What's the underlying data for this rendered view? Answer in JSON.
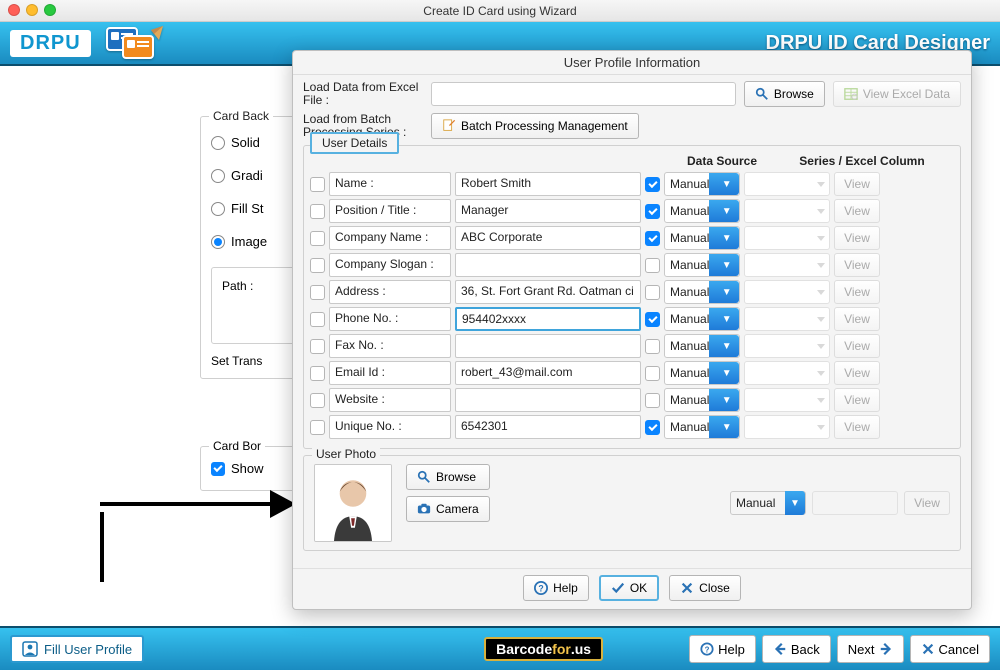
{
  "window": {
    "title": "Create ID Card using Wizard"
  },
  "brand": {
    "logo": "DRPU",
    "title": "DRPU ID Card Designer"
  },
  "dialog": {
    "title": "User Profile Information",
    "load_excel_label": "Load Data from Excel File :",
    "browse_label": "Browse",
    "view_excel_label": "View Excel Data",
    "load_batch_label": "Load from Batch Processing Series :",
    "batch_btn": "Batch Processing Management",
    "tab_label": "User Details",
    "header_data_source": "Data Source",
    "header_series": "Series / Excel Column",
    "rows": [
      {
        "name": "Name :",
        "value": "Robert Smith",
        "checked": true
      },
      {
        "name": "Position / Title :",
        "value": "Manager",
        "checked": true
      },
      {
        "name": "Company Name :",
        "value": "ABC Corporate",
        "checked": true
      },
      {
        "name": "Company Slogan :",
        "value": "",
        "checked": false
      },
      {
        "name": "Address :",
        "value": "36, St. Fort Grant Rd. Oatman ci",
        "checked": false
      },
      {
        "name": "Phone No. :",
        "value": "954402xxxx",
        "checked": true
      },
      {
        "name": "Fax No. :",
        "value": "",
        "checked": false
      },
      {
        "name": "Email Id :",
        "value": "robert_43@mail.com",
        "checked": false
      },
      {
        "name": "Website :",
        "value": "",
        "checked": false
      },
      {
        "name": "Unique No. :",
        "value": "6542301",
        "checked": true
      }
    ],
    "data_source_value": "Manual",
    "view_label": "View",
    "photo_group": "User Photo",
    "photo_browse": "Browse",
    "photo_camera": "Camera",
    "help": "Help",
    "ok": "OK",
    "close": "Close"
  },
  "background": {
    "group1_title": "Card Back",
    "opt_solid": "Solid",
    "opt_gradi": "Gradi",
    "opt_fill": "Fill St",
    "opt_image": "Image",
    "path_label": "Path :",
    "set_trans": "Set Trans",
    "group3_title": "Card Bor",
    "show": "Show"
  },
  "bottombar": {
    "chip": "Fill User Profile",
    "site_a": "Barcode",
    "site_b": "for",
    "site_c": ".us",
    "help": "Help",
    "back": "Back",
    "next": "Next",
    "cancel": "Cancel"
  }
}
